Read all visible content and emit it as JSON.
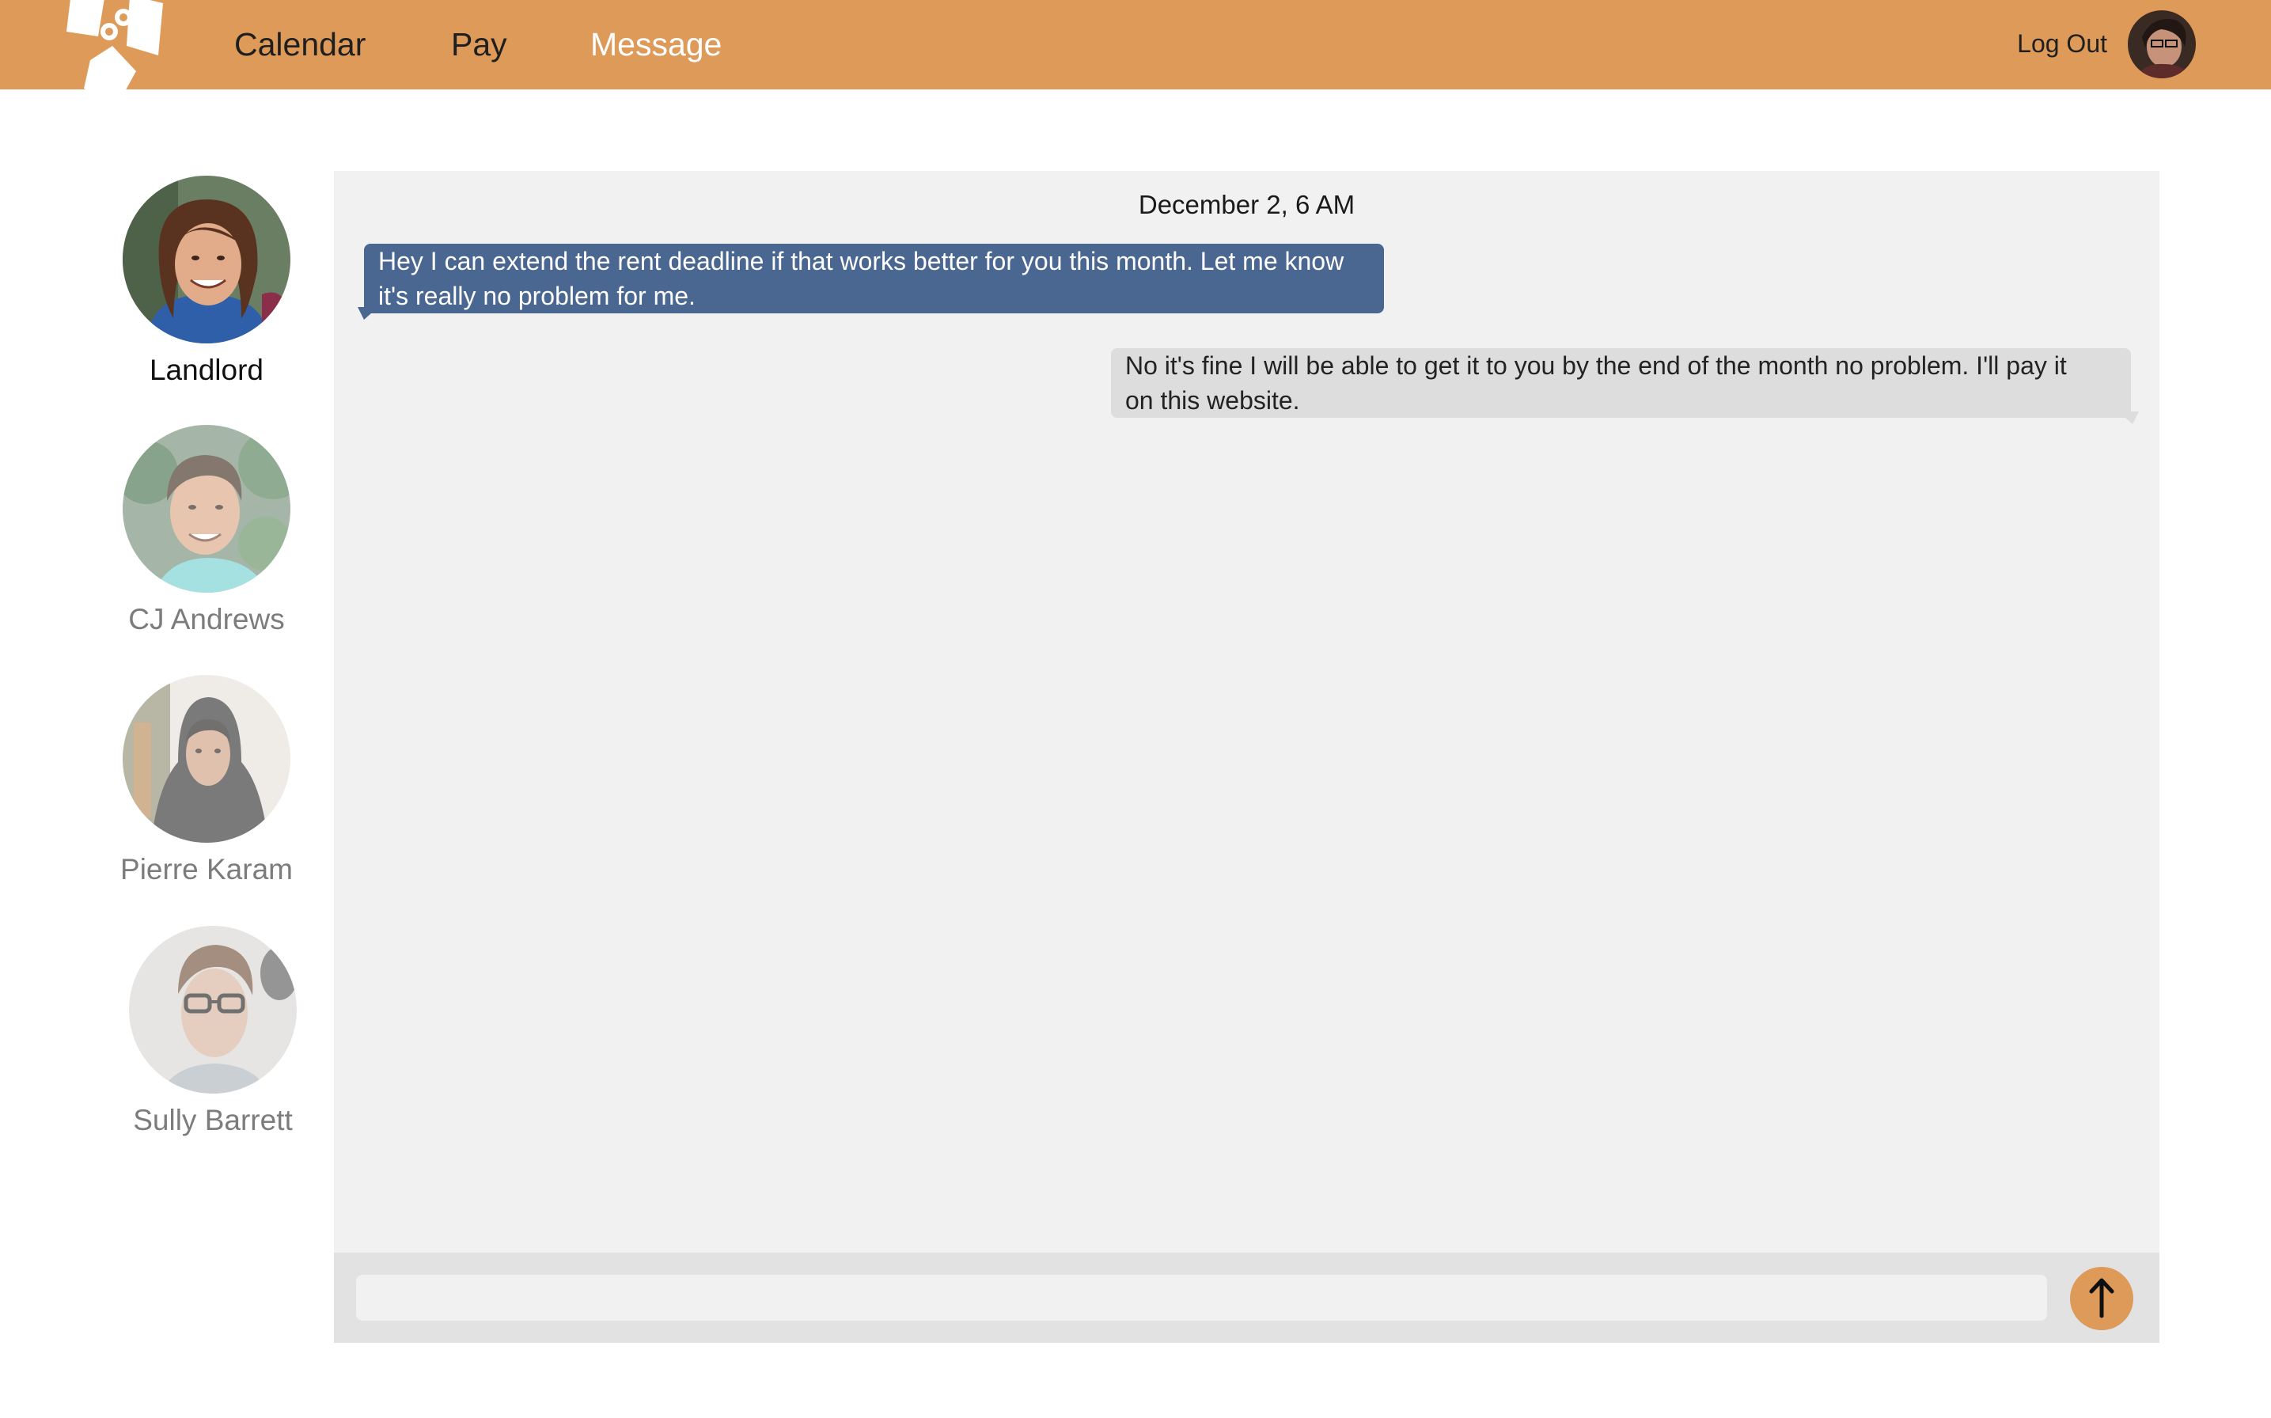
{
  "header": {
    "nav": [
      {
        "label": "Calendar",
        "active": false
      },
      {
        "label": "Pay",
        "active": false
      },
      {
        "label": "Message",
        "active": true
      }
    ],
    "logout_label": "Log Out",
    "logo_icon": "house-keys-logo-icon",
    "avatar_icon": "user-avatar"
  },
  "contacts": [
    {
      "name": "Landlord",
      "selected": true
    },
    {
      "name": "CJ Andrews",
      "selected": false
    },
    {
      "name": "Pierre Karam",
      "selected": false
    },
    {
      "name": "Sully Barrett",
      "selected": false
    }
  ],
  "chat": {
    "date": "December 2, 6 AM",
    "messages": [
      {
        "direction": "incoming",
        "line1": "Hey I can extend the rent deadline if that works better for you this month. Let me know",
        "line2": "it's really no problem for me."
      },
      {
        "direction": "outgoing",
        "line1": "No it's fine I will be able to get it to you by the end of the month no problem. I'll pay it",
        "line2": "on this website."
      }
    ],
    "input_value": "",
    "input_placeholder": "",
    "send_icon": "arrow-up-icon"
  },
  "colors": {
    "header_bg": "#dd9a59",
    "incoming_bubble": "#4a6792",
    "outgoing_bubble": "#dddddd",
    "chat_bg": "#f1f1f1",
    "send_button": "#dd9a59"
  }
}
